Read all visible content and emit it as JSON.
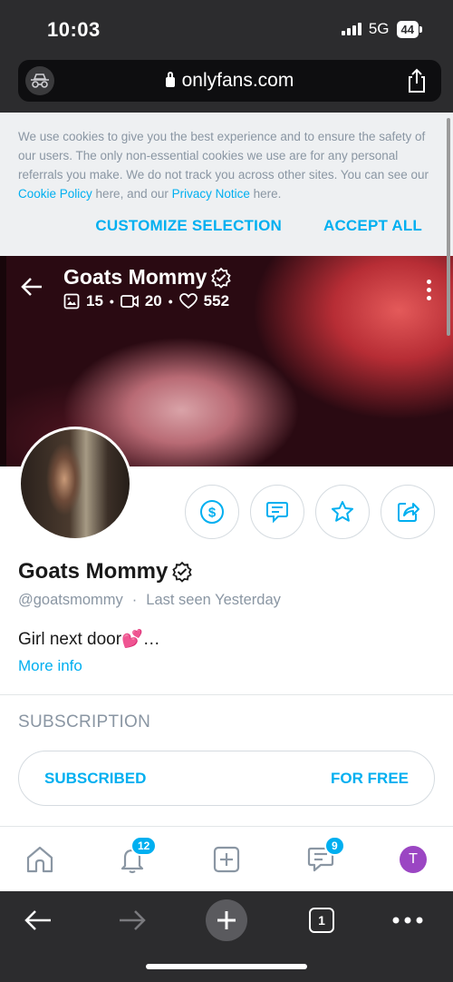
{
  "status_bar": {
    "time": "10:03",
    "network": "5G",
    "battery": "44"
  },
  "browser": {
    "url": "onlyfans.com",
    "tab_count": "1"
  },
  "cookie_banner": {
    "text_1": "We use cookies to give you the best experience and to ensure the safety of our users. The only non-essential cookies we use are for any personal referrals you make. We do not track you across other sites. You can see our ",
    "cookie_policy_link": "Cookie Policy",
    "text_2": " here, and our ",
    "privacy_link": "Privacy Notice",
    "text_3": " here.",
    "customize_label": "CUSTOMIZE SELECTION",
    "accept_label": "ACCEPT ALL"
  },
  "cover": {
    "title": "Goats Mommy",
    "photos": "15",
    "videos": "20",
    "likes": "552"
  },
  "profile": {
    "name": "Goats Mommy",
    "handle": "@goatsmommy",
    "separator": "·",
    "last_seen": "Last seen Yesterday",
    "bio": "Girl next door💕…",
    "more_info": "More info"
  },
  "subscription": {
    "heading": "SUBSCRIPTION",
    "status": "SUBSCRIBED",
    "price": "FOR FREE"
  },
  "bottom_nav": {
    "notifications_badge": "12",
    "messages_badge": "9",
    "user_initial": "T"
  },
  "colors": {
    "accent": "#00aff0",
    "muted": "#8a96a3",
    "user_avatar": "#9b46c3"
  },
  "icons": [
    "incognito-icon",
    "lock-icon",
    "share-icon",
    "back-arrow-icon",
    "verified-icon",
    "image-icon",
    "video-icon",
    "heart-icon",
    "more-vertical-icon",
    "dollar-icon",
    "message-icon",
    "star-icon",
    "share-profile-icon",
    "home-icon",
    "bell-icon",
    "add-post-icon",
    "chat-icon",
    "plus-icon",
    "forward-icon",
    "ellipsis-icon"
  ]
}
